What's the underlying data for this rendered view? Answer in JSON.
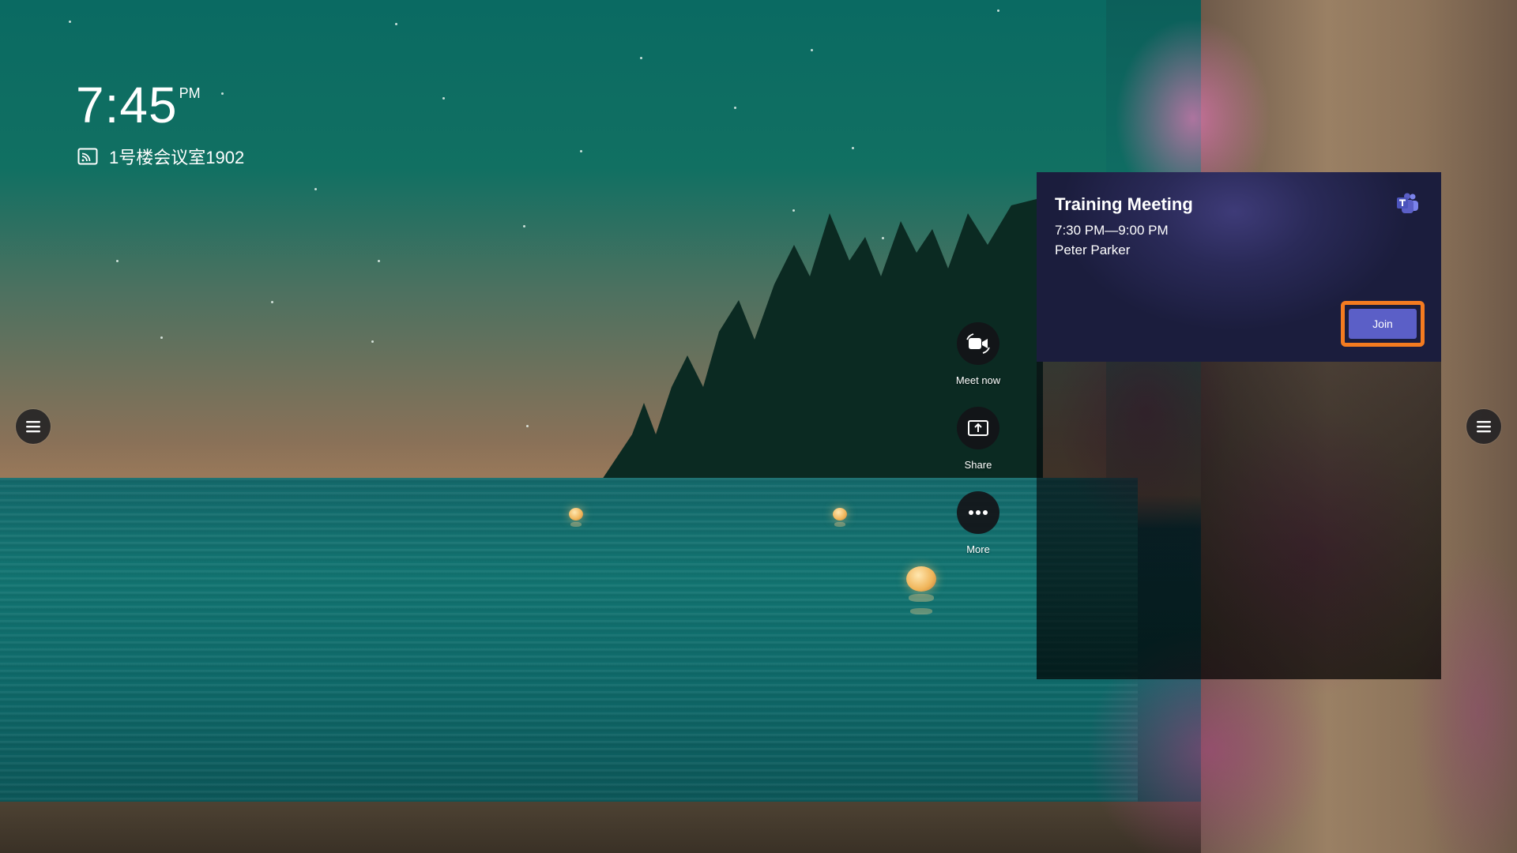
{
  "clock": {
    "time": "7:45",
    "ampm": "PM"
  },
  "room": {
    "icon": "cast-icon",
    "name": "1号楼会议室1902"
  },
  "actions": [
    {
      "icon": "video-camera-icon",
      "label": "Meet now"
    },
    {
      "icon": "share-screen-icon",
      "label": "Share"
    },
    {
      "icon": "more-icon",
      "label": "More"
    }
  ],
  "meeting": {
    "title": "Training Meeting",
    "time": "7:30 PM—9:00 PM",
    "organizer": "Peter Parker",
    "join_label": "Join",
    "app_icon": "teams-icon"
  },
  "colors": {
    "join": "#5b5fc7",
    "highlight": "#f47b20",
    "card": "#2a2a58"
  }
}
